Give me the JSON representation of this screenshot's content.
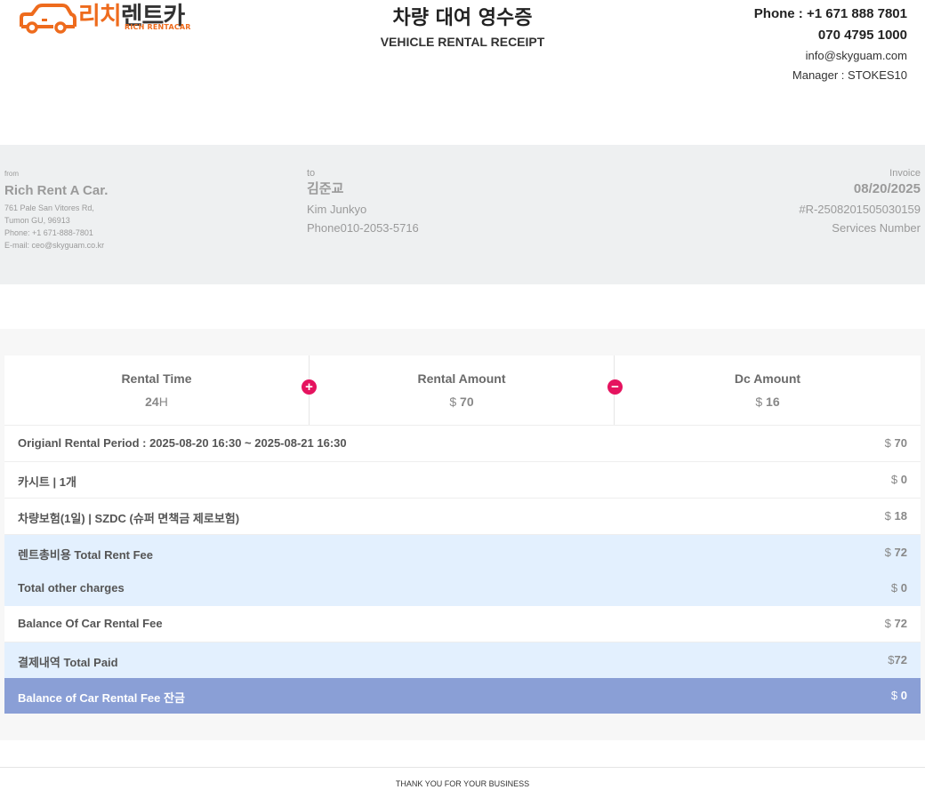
{
  "header": {
    "logo_ko_a": "리치",
    "logo_ko_b": "렌트카",
    "logo_en": "RICH RENTACAR",
    "title_ko": "차량 대여 영수증",
    "title_en": "VEHICLE RENTAL RECEIPT",
    "phone": "Phone : +1 671 888 7801",
    "phone2": "070 4795 1000",
    "email": "info@skyguam.com",
    "manager": "Manager : STOKES10"
  },
  "from": {
    "label": "from",
    "name": "Rich Rent A Car.",
    "address1": "761 Pale San Vitores Rd,",
    "address2": "Tumon GU, 96913",
    "phone": "Phone: +1 671-888-7801",
    "email": "E-mail: ceo@skyguam.co.kr"
  },
  "to": {
    "label": "to",
    "name_ko": "김준교",
    "name_en": "Kim Junkyo",
    "phone": "Phone010-2053-5716"
  },
  "invoice": {
    "label": "Invoice",
    "date": "08/20/2025",
    "number": "#R-2508201505030159",
    "services": "Services Number"
  },
  "stats": {
    "rental_time_label": "Rental Time",
    "rental_time_value": "24",
    "rental_time_unit": "H",
    "rental_amount_label": "Rental Amount",
    "rental_amount_currency": "$",
    "rental_amount_value": "70",
    "dc_amount_label": "Dc Amount",
    "dc_amount_currency": "$",
    "dc_amount_value": "16",
    "plus_symbol": "+",
    "minus_symbol": "−"
  },
  "rows": [
    {
      "label": "Origianl Rental Period : 2025-08-20 16:30 ~ 2025-08-21 16:30",
      "currency": "$",
      "amount": "70"
    },
    {
      "label": "카시트 | 1개",
      "currency": "$",
      "amount": "0"
    },
    {
      "label": "차량보험(1일) | SZDC (슈퍼 면책금 제로보험)",
      "currency": "$",
      "amount": "18"
    },
    {
      "label": "렌트총비용 Total Rent Fee",
      "currency": "$",
      "amount": "72"
    },
    {
      "label": "Total other charges",
      "currency": "$",
      "amount": "0"
    },
    {
      "label": "Balance Of Car Rental Fee",
      "currency": "$",
      "amount": "72"
    },
    {
      "label": "결제내역 Total Paid",
      "currency": "$",
      "amount": "72"
    },
    {
      "label": "Balance of Car Rental Fee 잔금",
      "currency": "$",
      "amount": "0"
    }
  ],
  "footer": "THANK YOU FOR YOUR BUSINESS",
  "colors": {
    "brand_orange": "#ee6b1d",
    "badge_pink": "#e5135f",
    "highlight_blue": "#e3f0fe",
    "total_bar": "#8a9fd6"
  }
}
